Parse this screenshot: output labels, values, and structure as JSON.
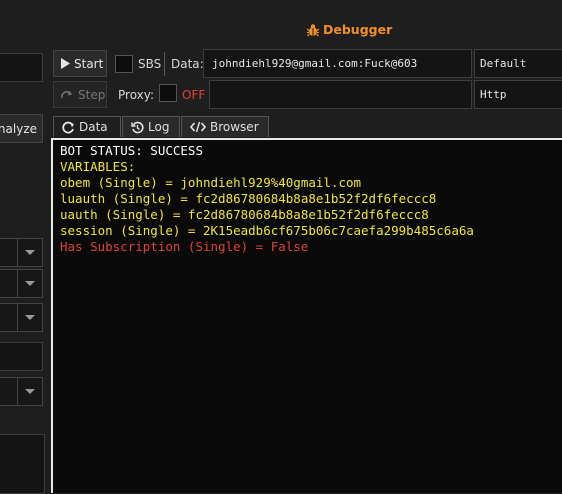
{
  "window": {
    "title": "Debugger",
    "title_color": "#f0902a"
  },
  "left_panel": {
    "analyze_label": "nalyze"
  },
  "toolbar": {
    "start_label": "Start",
    "step_label": "Step",
    "sbs_label": "SBS",
    "data_label": "Data:",
    "data_value": "johndiehl929@gmail.com:Fuck@603",
    "data_type_value": "Default",
    "proxy_label": "Proxy:",
    "proxy_state": "OFF",
    "proxy_value": "",
    "proxy_type_value": "Http"
  },
  "tabs": [
    {
      "label": "Data",
      "icon": "refresh-icon"
    },
    {
      "label": "Log",
      "icon": "history-icon"
    },
    {
      "label": "Browser",
      "icon": "code-icon"
    }
  ],
  "console": {
    "lines": [
      {
        "text": "BOT STATUS: SUCCESS",
        "color": "#ffffff"
      },
      {
        "text": "VARIABLES:",
        "color": "#f0e442"
      },
      {
        "text": "obem (Single) = johndiehl929%40gmail.com",
        "color": "#f0e442"
      },
      {
        "text": "luauth (Single) = fc2d86780684b8a8e1b52f2df6feccc8",
        "color": "#f0e442"
      },
      {
        "text": "uauth (Single) = fc2d86780684b8a8e1b52f2df6feccc8",
        "color": "#f0e442"
      },
      {
        "text": "session (Single) = 2K15eadb6cf675b06c7caefa299b485c6a6a",
        "color": "#f0e442"
      },
      {
        "text": "Has Subscription (Single) = False",
        "color": "#e0413a"
      }
    ]
  }
}
